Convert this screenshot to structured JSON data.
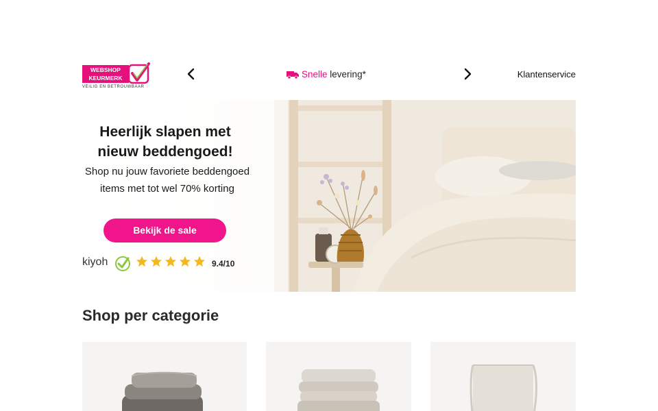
{
  "header": {
    "logo": {
      "line1": "WEBSHOP",
      "line2": "KEURMERK",
      "tagline": "VEILIG EN BETROUWBAAR"
    },
    "usp": {
      "highlight": "Snelle",
      "rest": "levering*"
    },
    "customer_service_label": "Klantenservice",
    "colors": {
      "brand_pink": "#e5107c"
    }
  },
  "hero": {
    "title_line1": "Heerlijk slapen met",
    "title_line2": "nieuw beddengoed!",
    "subtitle_line1": "Shop nu jouw favoriete beddengoed",
    "subtitle_line2": "items met tot wel 70% korting",
    "cta_label": "Bekijk de sale",
    "rating": {
      "brand": "kiyoh",
      "stars": 5,
      "score": "9.4/10"
    }
  },
  "categories": {
    "title": "Shop per categorie",
    "cards": [
      {
        "icon": "pillows-stack-icon"
      },
      {
        "icon": "duvet-folded-icon"
      },
      {
        "icon": "fitted-sheet-icon"
      }
    ]
  }
}
